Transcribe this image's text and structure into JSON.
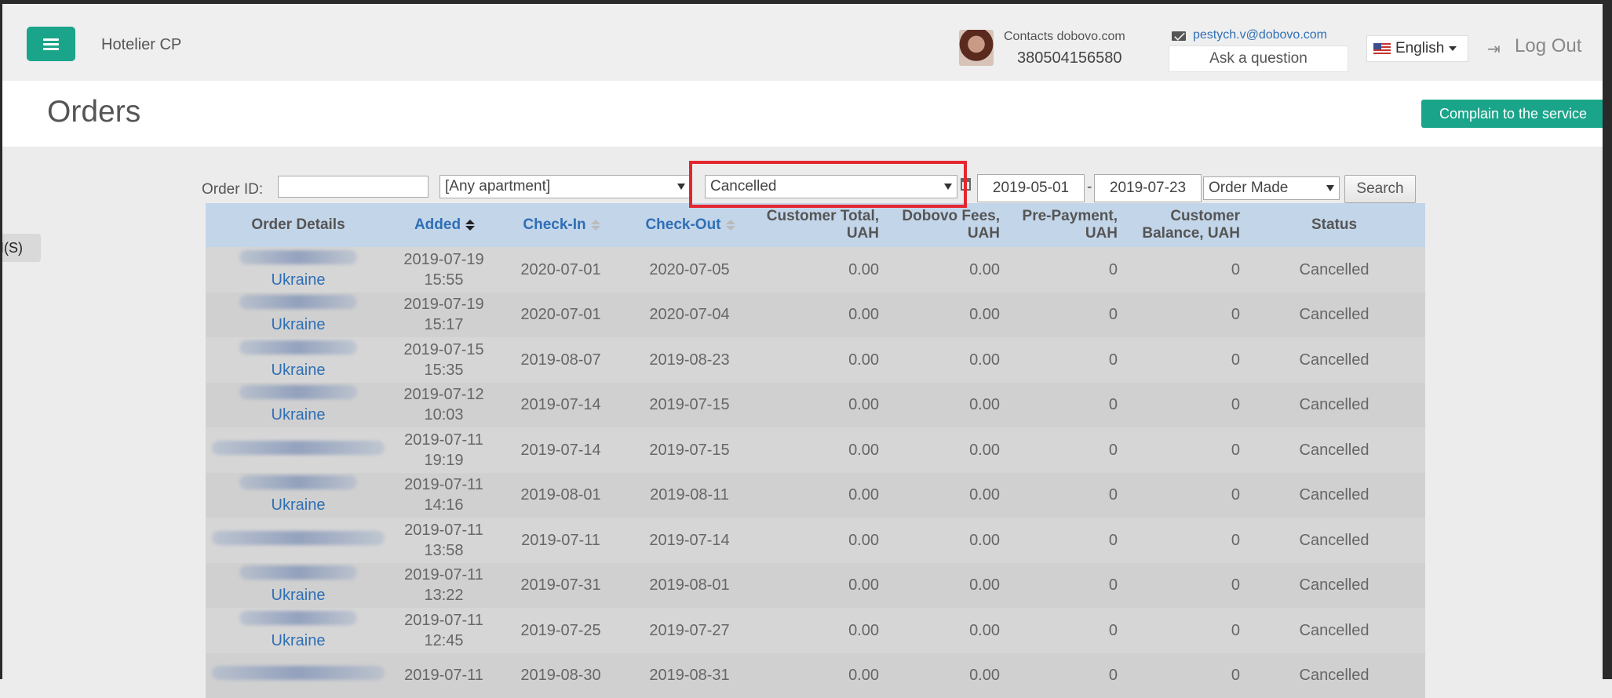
{
  "nav": {
    "brand": "Hotelier CP",
    "contacts_label": "Contacts dobovo.com",
    "phone": "380504156580",
    "email": "pestych.v@dobovo.com",
    "ask_label": "Ask a question",
    "language": "English",
    "logout_label": "Log Out"
  },
  "page": {
    "title": "Orders",
    "complain_label": "Complain to the service",
    "side_tab": "I(S)"
  },
  "filters": {
    "order_id_label": "Order ID:",
    "order_id_value": "",
    "apartment": "[Any apartment]",
    "status": "Cancelled",
    "date_from": "2019-05-01",
    "date_separator": "-",
    "date_to": "2019-07-23",
    "date_type": "Order Made",
    "search_label": "Search"
  },
  "table": {
    "headers": {
      "details": "Order Details",
      "added": "Added",
      "checkin": "Check-In",
      "checkout": "Check-Out",
      "total": "Customer Total, UAH",
      "fees": "Dobovo Fees, UAH",
      "prepay": "Pre-Payment, UAH",
      "balance": "Customer Balance, UAH",
      "status": "Status"
    },
    "rows": [
      {
        "country": "Ukraine",
        "date": "2019-07-19",
        "time": "15:55",
        "checkin": "2020-07-01",
        "checkout": "2020-07-05",
        "total": "0.00",
        "fees": "0.00",
        "prepay": "0",
        "balance": "0",
        "status": "Cancelled"
      },
      {
        "country": "Ukraine",
        "date": "2019-07-19",
        "time": "15:17",
        "checkin": "2020-07-01",
        "checkout": "2020-07-04",
        "total": "0.00",
        "fees": "0.00",
        "prepay": "0",
        "balance": "0",
        "status": "Cancelled"
      },
      {
        "country": "Ukraine",
        "date": "2019-07-15",
        "time": "15:35",
        "checkin": "2019-08-07",
        "checkout": "2019-08-23",
        "total": "0.00",
        "fees": "0.00",
        "prepay": "0",
        "balance": "0",
        "status": "Cancelled"
      },
      {
        "country": "Ukraine",
        "date": "2019-07-12",
        "time": "10:03",
        "checkin": "2019-07-14",
        "checkout": "2019-07-15",
        "total": "0.00",
        "fees": "0.00",
        "prepay": "0",
        "balance": "0",
        "status": "Cancelled"
      },
      {
        "country": "",
        "date": "2019-07-11",
        "time": "19:19",
        "checkin": "2019-07-14",
        "checkout": "2019-07-15",
        "total": "0.00",
        "fees": "0.00",
        "prepay": "0",
        "balance": "0",
        "status": "Cancelled"
      },
      {
        "country": "Ukraine",
        "date": "2019-07-11",
        "time": "14:16",
        "checkin": "2019-08-01",
        "checkout": "2019-08-11",
        "total": "0.00",
        "fees": "0.00",
        "prepay": "0",
        "balance": "0",
        "status": "Cancelled"
      },
      {
        "country": "",
        "date": "2019-07-11",
        "time": "13:58",
        "checkin": "2019-07-11",
        "checkout": "2019-07-14",
        "total": "0.00",
        "fees": "0.00",
        "prepay": "0",
        "balance": "0",
        "status": "Cancelled"
      },
      {
        "country": "Ukraine",
        "date": "2019-07-11",
        "time": "13:22",
        "checkin": "2019-07-31",
        "checkout": "2019-08-01",
        "total": "0.00",
        "fees": "0.00",
        "prepay": "0",
        "balance": "0",
        "status": "Cancelled"
      },
      {
        "country": "Ukraine",
        "date": "2019-07-11",
        "time": "12:45",
        "checkin": "2019-07-25",
        "checkout": "2019-07-27",
        "total": "0.00",
        "fees": "0.00",
        "prepay": "0",
        "balance": "0",
        "status": "Cancelled"
      },
      {
        "country": "",
        "date": "2019-07-11",
        "time": "",
        "checkin": "2019-08-30",
        "checkout": "2019-08-31",
        "total": "0.00",
        "fees": "0.00",
        "prepay": "0",
        "balance": "0",
        "status": "Cancelled"
      }
    ]
  }
}
